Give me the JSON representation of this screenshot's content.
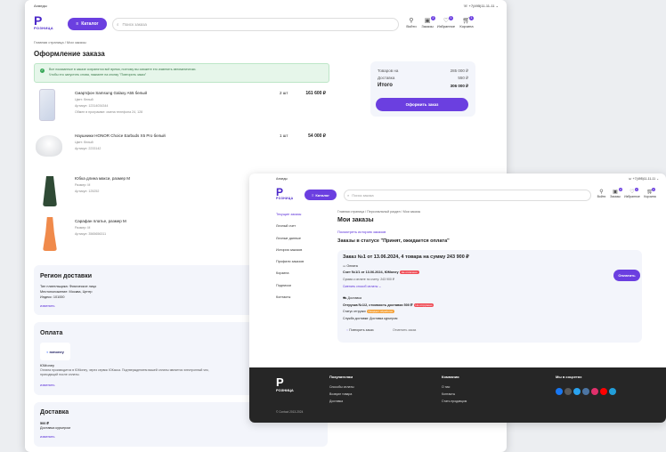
{
  "w1": {
    "city": "Ахмеды",
    "phone": "+7(495)11-11-11",
    "logo_mark": "P",
    "logo_sub": "РОЗНИЦА",
    "catalog": "Каталог",
    "search_ph": "Поиск заказа",
    "nav": [
      "Войти",
      "Заказы",
      "Избранное",
      "Корзина"
    ],
    "badges": [
      "",
      "2",
      "1",
      "1"
    ],
    "breadcrumb": "Главная страница / Мои заказы",
    "title": "Оформление заказа",
    "alert_line1": "Все показанные в заказе сохранятся всё время, поэтому вы сможете его изменить автоматически.",
    "alert_line2": "Чтобы его запустить снова, нажмите на кнопку \"Повторить заказ\"",
    "summary": {
      "l1": "Товаров на",
      "v1": "285 000 ₽",
      "l2": "Доставка",
      "v2": "550 ₽",
      "l3": "Итого",
      "v3": "306 000 ₽",
      "btn": "Оформить заказ"
    },
    "items": [
      {
        "name": "Смартфон Samsung Galaxy A55 белый",
        "c1": "Цвет: белый",
        "c2": "Артикул: 12314034344",
        "c3": "Обмен в программе: смена телефона 24, 128",
        "qty": "2 шт",
        "price": "161 600 ₽"
      },
      {
        "name": "Наушники HONOR Choice Earbuds X5 Pro белый",
        "c1": "Цвет: белый",
        "c2": "Артикул: 2233142",
        "c3": "",
        "qty": "1 шт",
        "price": "54 000 ₽"
      },
      {
        "name": "Юбка длина макси, размер M",
        "c1": "Размер: M",
        "c2": "Артикул: 125252",
        "c3": "",
        "qty": "",
        "price": ""
      },
      {
        "name": "Сарафан платье, размер M",
        "c1": "Размер: M",
        "c2": "Артикул: 3565656311",
        "c3": "",
        "qty": "",
        "price": ""
      }
    ],
    "region": {
      "title": "Регион доставки",
      "l1": "Тип плательщика: Физическое лицо",
      "l2": "Местоположение: Москва, Центр",
      "l3": "Индекс: 101000",
      "edit": "изменить"
    },
    "payment": {
      "title": "Оплата",
      "logo": "юmoney",
      "name": "ЮMoney",
      "d1": "Оплата производится в ЮMoney, через сервис ЮКасса. Подтверждением вашей оплаты является электронный чек,",
      "d2": "приходящий после оплаты.",
      "edit": "изменить"
    },
    "delivery": {
      "title": "Доставка",
      "l1": "500 ₽",
      "l2": "Доставка курьером",
      "edit": "изменить"
    }
  },
  "w2": {
    "city": "Ахмеды",
    "phone": "+7(495)11-11-11",
    "logo_mark": "P",
    "logo_sub": "РОЗНИЦА",
    "catalog": "Каталог",
    "search_ph": "Поиск заказа",
    "nav": [
      "Войти",
      "Заказы",
      "Избранное",
      "Корзина"
    ],
    "badges": [
      "",
      "2",
      "1",
      "1"
    ],
    "sidebar": [
      "Текущие заказы",
      "Личный счет",
      "Личные данные",
      "История заказов",
      "Профили заказов",
      "Корзина",
      "Подписки",
      "Контакты"
    ],
    "breadcrumb": "Главная страница / Персональный раздел / Мои заказы",
    "title": "Мои заказы",
    "history_link": "Посмотреть историю заказов",
    "status_head": "Заказы в статусе \"Принят, ожидается оплата\"",
    "order_title": "Заказ №1 от 13.06.2024, 4 товара на сумму 243 900 ₽",
    "pay_section": "Оплата",
    "invoice": "Счет №1/1 от 13.06.2024, ЮMoney",
    "unpaid": "Не оплачено",
    "sum": "Сумма к оплате по счету: 243 900 ₽",
    "change_pay": "Сменить способ оплаты",
    "pay_btn": "Оплатить",
    "delivery_section": "Доставка",
    "shipment": "Отгрузка №1/2, стоимость доставки 500 ₽",
    "not_shipped": "Не отгружено",
    "ship_status_label": "Статус отгрузки",
    "ship_status": "Ожидает обработки",
    "service": "Служба доставки: Доставка курьером",
    "repeat": "Повторить заказ",
    "cancel": "Отменить заказ",
    "footer": {
      "mark": "P",
      "brand": "РОЗНИЦА",
      "copy": "© Contact 2013-2024",
      "col1_title": "Покупателям",
      "col1": [
        "Способы оплаты",
        "Возврат товара",
        "Доставка"
      ],
      "col2_title": "Компания",
      "col2": [
        "О нас",
        "Контакты",
        "Стать продавцом"
      ],
      "col3_title": "Мы в соцсетях"
    },
    "social_colors": [
      "#1877f2",
      "#5b5b5b",
      "#2aa3ef",
      "#4c75a3",
      "#e1306c",
      "#ff0000",
      "#229ed9"
    ]
  },
  "colors": {
    "accent": "#6b3fe0",
    "alert_bg": "#e6f6ea",
    "alert_border": "#bde6c7"
  }
}
